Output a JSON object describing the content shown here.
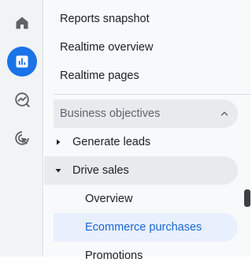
{
  "rail": {
    "items": [
      {
        "icon": "home-icon"
      },
      {
        "icon": "reports-icon",
        "selected": true
      },
      {
        "icon": "explore-icon"
      },
      {
        "icon": "advertising-icon"
      }
    ],
    "accent": "#1a73e8"
  },
  "nav": {
    "top_items": [
      "Reports snapshot",
      "Realtime overview",
      "Realtime pages"
    ],
    "section": {
      "label": "Business objectives",
      "state": "expanded",
      "groups": [
        {
          "label": "Generate leads",
          "expanded": false
        },
        {
          "label": "Drive sales",
          "expanded": true,
          "items": [
            {
              "label": "Overview",
              "active": false
            },
            {
              "label": "Ecommerce purchases",
              "active": true
            },
            {
              "label": "Promotions",
              "active": false
            }
          ]
        }
      ]
    }
  },
  "colors": {
    "active_text": "#1967d2",
    "active_bg": "#e8f0fe",
    "panel_bg": "#f8f9fa"
  }
}
